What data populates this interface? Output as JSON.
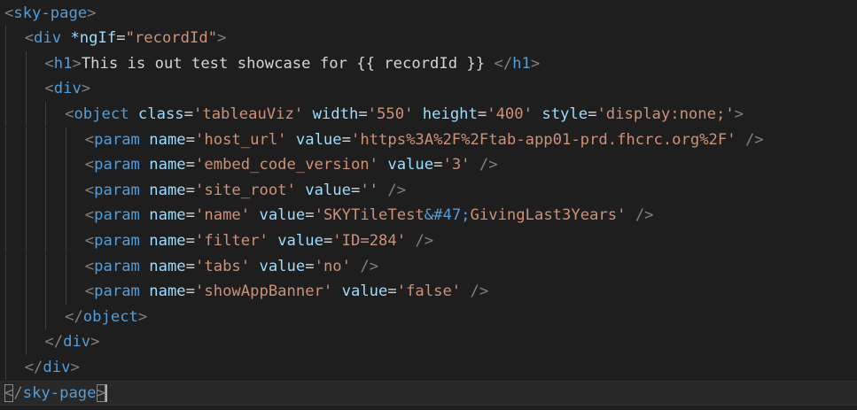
{
  "editor": {
    "lines": [
      {
        "indent": 0,
        "tokens": [
          {
            "t": "punct",
            "v": "<"
          },
          {
            "t": "tag",
            "v": "sky-page"
          },
          {
            "t": "punct",
            "v": ">"
          }
        ]
      },
      {
        "indent": 1,
        "tokens": [
          {
            "t": "punct",
            "v": "<"
          },
          {
            "t": "tag",
            "v": "div"
          },
          {
            "t": "text",
            "v": " "
          },
          {
            "t": "attr",
            "v": "*ngIf"
          },
          {
            "t": "text",
            "v": "="
          },
          {
            "t": "str",
            "v": "\"recordId\""
          },
          {
            "t": "punct",
            "v": ">"
          }
        ]
      },
      {
        "indent": 2,
        "tokens": [
          {
            "t": "punct",
            "v": "<"
          },
          {
            "t": "tag",
            "v": "h1"
          },
          {
            "t": "punct",
            "v": ">"
          },
          {
            "t": "text",
            "v": "This is out test showcase for {{ recordId }} "
          },
          {
            "t": "punct",
            "v": "</"
          },
          {
            "t": "tag",
            "v": "h1"
          },
          {
            "t": "punct",
            "v": ">"
          }
        ]
      },
      {
        "indent": 2,
        "tokens": [
          {
            "t": "punct",
            "v": "<"
          },
          {
            "t": "tag",
            "v": "div"
          },
          {
            "t": "punct",
            "v": ">"
          }
        ]
      },
      {
        "indent": 3,
        "tokens": [
          {
            "t": "punct",
            "v": "<"
          },
          {
            "t": "tag",
            "v": "object"
          },
          {
            "t": "text",
            "v": " "
          },
          {
            "t": "attr",
            "v": "class"
          },
          {
            "t": "text",
            "v": "="
          },
          {
            "t": "str",
            "v": "'tableauViz'"
          },
          {
            "t": "text",
            "v": " "
          },
          {
            "t": "attr",
            "v": "width"
          },
          {
            "t": "text",
            "v": "="
          },
          {
            "t": "str",
            "v": "'550'"
          },
          {
            "t": "text",
            "v": " "
          },
          {
            "t": "attr",
            "v": "height"
          },
          {
            "t": "text",
            "v": "="
          },
          {
            "t": "str",
            "v": "'400'"
          },
          {
            "t": "text",
            "v": " "
          },
          {
            "t": "attr",
            "v": "style"
          },
          {
            "t": "text",
            "v": "="
          },
          {
            "t": "str",
            "v": "'display:none;'"
          },
          {
            "t": "punct",
            "v": ">"
          }
        ]
      },
      {
        "indent": 4,
        "tokens": [
          {
            "t": "punct",
            "v": "<"
          },
          {
            "t": "tag",
            "v": "param"
          },
          {
            "t": "text",
            "v": " "
          },
          {
            "t": "attr",
            "v": "name"
          },
          {
            "t": "text",
            "v": "="
          },
          {
            "t": "str",
            "v": "'host_url'"
          },
          {
            "t": "text",
            "v": " "
          },
          {
            "t": "attr",
            "v": "value"
          },
          {
            "t": "text",
            "v": "="
          },
          {
            "t": "str",
            "v": "'https%3A%2F%2Ftab-app01-prd.fhcrc.org%2F'"
          },
          {
            "t": "text",
            "v": " "
          },
          {
            "t": "punct",
            "v": "/>"
          }
        ]
      },
      {
        "indent": 4,
        "tokens": [
          {
            "t": "punct",
            "v": "<"
          },
          {
            "t": "tag",
            "v": "param"
          },
          {
            "t": "text",
            "v": " "
          },
          {
            "t": "attr",
            "v": "name"
          },
          {
            "t": "text",
            "v": "="
          },
          {
            "t": "str",
            "v": "'embed_code_version'"
          },
          {
            "t": "text",
            "v": " "
          },
          {
            "t": "attr",
            "v": "value"
          },
          {
            "t": "text",
            "v": "="
          },
          {
            "t": "str",
            "v": "'3'"
          },
          {
            "t": "text",
            "v": " "
          },
          {
            "t": "punct",
            "v": "/>"
          }
        ]
      },
      {
        "indent": 4,
        "tokens": [
          {
            "t": "punct",
            "v": "<"
          },
          {
            "t": "tag",
            "v": "param"
          },
          {
            "t": "text",
            "v": " "
          },
          {
            "t": "attr",
            "v": "name"
          },
          {
            "t": "text",
            "v": "="
          },
          {
            "t": "str",
            "v": "'site_root'"
          },
          {
            "t": "text",
            "v": " "
          },
          {
            "t": "attr",
            "v": "value"
          },
          {
            "t": "text",
            "v": "="
          },
          {
            "t": "str",
            "v": "''"
          },
          {
            "t": "text",
            "v": " "
          },
          {
            "t": "punct",
            "v": "/>"
          }
        ]
      },
      {
        "indent": 4,
        "tokens": [
          {
            "t": "punct",
            "v": "<"
          },
          {
            "t": "tag",
            "v": "param"
          },
          {
            "t": "text",
            "v": " "
          },
          {
            "t": "attr",
            "v": "name"
          },
          {
            "t": "text",
            "v": "="
          },
          {
            "t": "str",
            "v": "'name'"
          },
          {
            "t": "text",
            "v": " "
          },
          {
            "t": "attr",
            "v": "value"
          },
          {
            "t": "text",
            "v": "="
          },
          {
            "t": "str",
            "v": "'SKYTileTest"
          },
          {
            "t": "tag",
            "v": "&#47;"
          },
          {
            "t": "str",
            "v": "GivingLast3Years'"
          },
          {
            "t": "text",
            "v": " "
          },
          {
            "t": "punct",
            "v": "/>"
          }
        ]
      },
      {
        "indent": 4,
        "tokens": [
          {
            "t": "punct",
            "v": "<"
          },
          {
            "t": "tag",
            "v": "param"
          },
          {
            "t": "text",
            "v": " "
          },
          {
            "t": "attr",
            "v": "name"
          },
          {
            "t": "text",
            "v": "="
          },
          {
            "t": "str",
            "v": "'filter'"
          },
          {
            "t": "text",
            "v": " "
          },
          {
            "t": "attr",
            "v": "value"
          },
          {
            "t": "text",
            "v": "="
          },
          {
            "t": "str",
            "v": "'ID=284'"
          },
          {
            "t": "text",
            "v": " "
          },
          {
            "t": "punct",
            "v": "/>"
          }
        ]
      },
      {
        "indent": 4,
        "tokens": [
          {
            "t": "punct",
            "v": "<"
          },
          {
            "t": "tag",
            "v": "param"
          },
          {
            "t": "text",
            "v": " "
          },
          {
            "t": "attr",
            "v": "name"
          },
          {
            "t": "text",
            "v": "="
          },
          {
            "t": "str",
            "v": "'tabs'"
          },
          {
            "t": "text",
            "v": " "
          },
          {
            "t": "attr",
            "v": "value"
          },
          {
            "t": "text",
            "v": "="
          },
          {
            "t": "str",
            "v": "'no'"
          },
          {
            "t": "text",
            "v": " "
          },
          {
            "t": "punct",
            "v": "/>"
          }
        ]
      },
      {
        "indent": 4,
        "tokens": [
          {
            "t": "punct",
            "v": "<"
          },
          {
            "t": "tag",
            "v": "param"
          },
          {
            "t": "text",
            "v": " "
          },
          {
            "t": "attr",
            "v": "name"
          },
          {
            "t": "text",
            "v": "="
          },
          {
            "t": "str",
            "v": "'showAppBanner'"
          },
          {
            "t": "text",
            "v": " "
          },
          {
            "t": "attr",
            "v": "value"
          },
          {
            "t": "text",
            "v": "="
          },
          {
            "t": "str",
            "v": "'false'"
          },
          {
            "t": "text",
            "v": " "
          },
          {
            "t": "punct",
            "v": "/>"
          }
        ]
      },
      {
        "indent": 3,
        "tokens": [
          {
            "t": "punct",
            "v": "</"
          },
          {
            "t": "tag",
            "v": "object"
          },
          {
            "t": "punct",
            "v": ">"
          }
        ]
      },
      {
        "indent": 2,
        "tokens": [
          {
            "t": "punct",
            "v": "</"
          },
          {
            "t": "tag",
            "v": "div"
          },
          {
            "t": "punct",
            "v": ">"
          }
        ]
      },
      {
        "indent": 1,
        "tokens": [
          {
            "t": "punct",
            "v": "</"
          },
          {
            "t": "tag",
            "v": "div"
          },
          {
            "t": "punct",
            "v": ">"
          }
        ]
      },
      {
        "indent": 0,
        "current": true,
        "tokens": [
          {
            "t": "punct",
            "v": "<",
            "match": true
          },
          {
            "t": "punct",
            "v": "/"
          },
          {
            "t": "tag",
            "v": "sky-page"
          },
          {
            "t": "punct",
            "v": ">",
            "match": true
          }
        ]
      }
    ]
  },
  "colors": {
    "background": "#1e1e1e",
    "tag": "#569cd6",
    "attribute": "#9cdcfe",
    "string": "#ce9178",
    "punctuation": "#808080",
    "text": "#d4d4d4"
  }
}
